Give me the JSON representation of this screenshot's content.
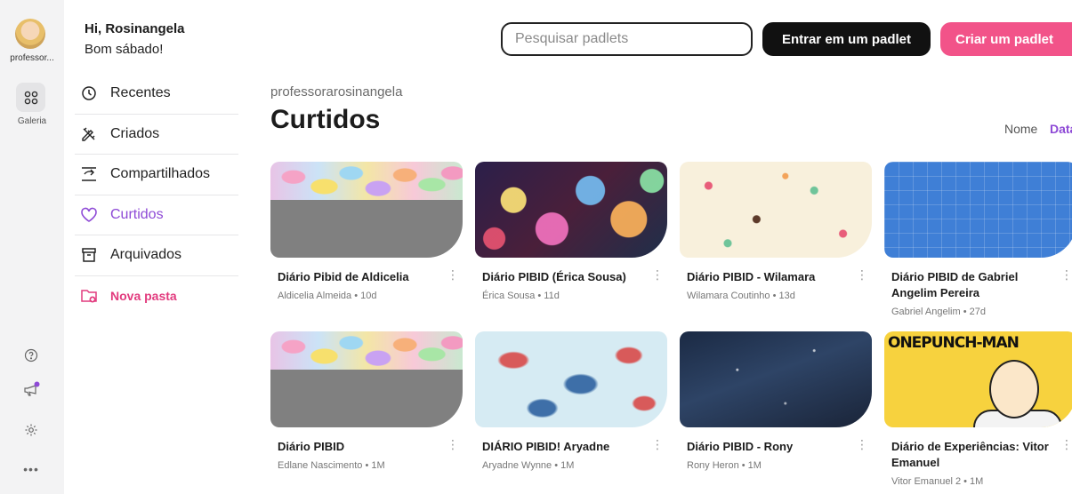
{
  "rail": {
    "user_label": "professor...",
    "galeria_label": "Galeria"
  },
  "greeting": {
    "name_line": "Hi, Rosinangela",
    "day_line": "Bom sábado!"
  },
  "nav": [
    {
      "label": "Recentes",
      "icon": "clock-icon"
    },
    {
      "label": "Criados",
      "icon": "pencil-ruler-icon"
    },
    {
      "label": "Compartilhados",
      "icon": "share-icon"
    },
    {
      "label": "Curtidos",
      "icon": "heart-icon"
    },
    {
      "label": "Arquivados",
      "icon": "archive-icon"
    },
    {
      "label": "Nova pasta",
      "icon": "new-folder-icon"
    }
  ],
  "header": {
    "search_placeholder": "Pesquisar padlets",
    "join_label": "Entrar em um padlet",
    "create_label": "Criar um padlet"
  },
  "main": {
    "owner": "professorarosinangela",
    "title": "Curtidos",
    "sort_name": "Nome",
    "sort_date": "Data"
  },
  "colors": {
    "accent_purple": "#8e4ad6",
    "accent_pink": "#f25389",
    "new_folder": "#e23b7e"
  },
  "cards": [
    {
      "title": "Diário Pibid de Aldicelia",
      "meta": "Aldicelia Almeida • 10d"
    },
    {
      "title": "Diário PIBID (Érica Sousa)",
      "meta": "Érica Sousa • 11d"
    },
    {
      "title": "Diário PIBID - Wilamara",
      "meta": "Wilamara Coutinho • 13d"
    },
    {
      "title": "Diário PIBID de Gabriel Angelim Pereira",
      "meta": "Gabriel Angelim • 27d"
    },
    {
      "title": "Diário PIBID",
      "meta": "Edlane Nascimento • 1M"
    },
    {
      "title": "DIÁRIO PIBID! Aryadne",
      "meta": "Aryadne Wynne • 1M"
    },
    {
      "title": "Diário PIBID - Rony",
      "meta": "Rony Heron • 1M"
    },
    {
      "title": "Diário de Experiências: Vitor Emanuel",
      "meta": "Vitor Emanuel 2 • 1M"
    }
  ],
  "opm_thumb_text": "ONEPUNCH-MAN"
}
